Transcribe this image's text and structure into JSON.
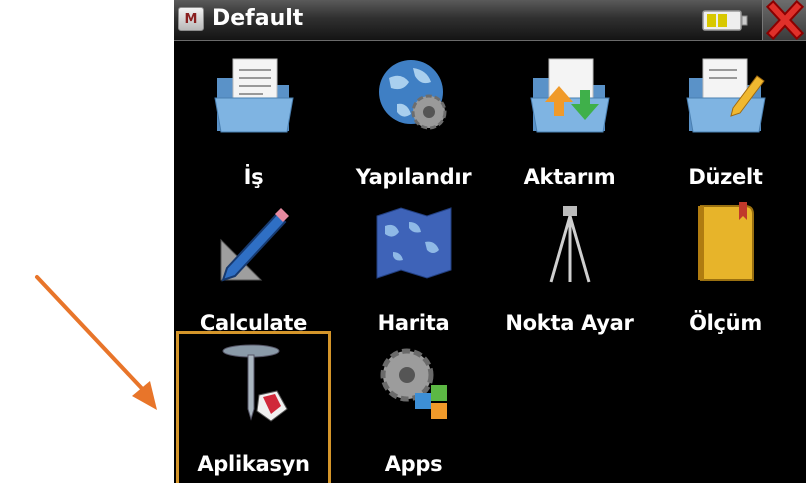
{
  "window": {
    "title": "Default",
    "app_badge": "M",
    "battery_icon": "battery-icon",
    "close_icon": "close-icon"
  },
  "grid": {
    "items": [
      {
        "label": "İş",
        "icon": "folder-document-icon"
      },
      {
        "label": "Yapılandır",
        "icon": "globe-gear-icon"
      },
      {
        "label": "Aktarım",
        "icon": "folder-transfer-icon"
      },
      {
        "label": "Düzelt",
        "icon": "folder-edit-icon"
      },
      {
        "label": "Calculate",
        "icon": "pencil-ruler-icon"
      },
      {
        "label": "Harita",
        "icon": "map-icon"
      },
      {
        "label": "Nokta Ayar",
        "icon": "tripod-icon"
      },
      {
        "label": "Ölçüm",
        "icon": "yellow-book-icon"
      },
      {
        "label": "Aplikasyn",
        "icon": "stake-out-icon",
        "selected": true
      },
      {
        "label": "Apps",
        "icon": "gear-apps-icon"
      }
    ]
  },
  "annotation": {
    "arrow_color": "#e8752a",
    "highlight_color": "#d4952a"
  }
}
